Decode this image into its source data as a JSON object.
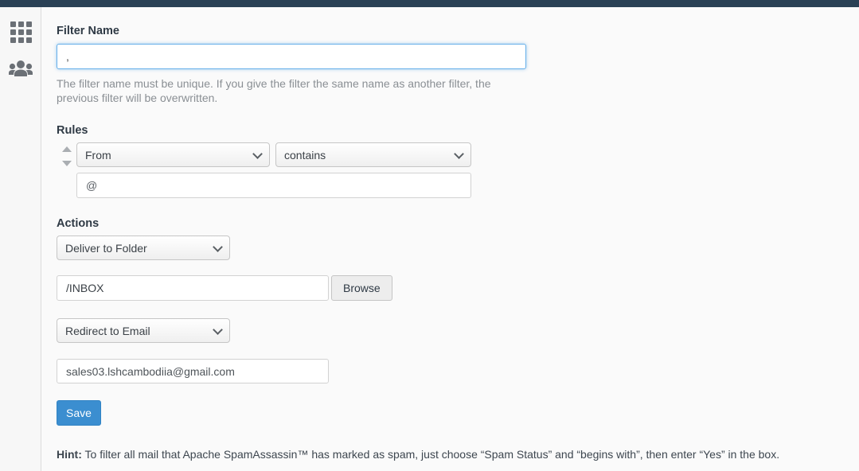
{
  "topbar": {
    "color": "#2a4155"
  },
  "sidebar": {
    "items": [
      {
        "icon": "apps-grid-icon",
        "name": "apps-grid"
      },
      {
        "icon": "users-group-icon",
        "name": "users-group"
      }
    ]
  },
  "form": {
    "filter_name": {
      "label": "Filter Name",
      "value": ",",
      "placeholder": "",
      "helper": "The filter name must be unique. If you give the filter the same name as another filter, the previous filter will be overwritten."
    },
    "rules": {
      "title": "Rules",
      "field_select": {
        "value": "From"
      },
      "operator_select": {
        "value": "contains"
      },
      "value_input": {
        "value": "@",
        "placeholder": ""
      },
      "reorder": {
        "up": "move-rule-up",
        "down": "move-rule-down"
      }
    },
    "actions": {
      "title": "Actions",
      "action_one": {
        "value": "Deliver to Folder"
      },
      "folder_input": {
        "value": "/INBOX",
        "placeholder": ""
      },
      "browse_label": "Browse",
      "action_two": {
        "value": "Redirect to Email"
      },
      "email_input": {
        "value": "sales03.lshcambodiia@gmail.com",
        "placeholder": ""
      }
    },
    "save_label": "Save"
  },
  "hint": {
    "prefix": "Hint:",
    "text": " To filter all mail that Apache SpamAssassin™ has marked as spam, just choose “Spam Status” and “begins with”, then enter “Yes” in the box."
  },
  "colors": {
    "topbar": "#2a4155",
    "accent": "#3b8ed0",
    "focus_ring": "#66afe9",
    "page_bg": "#fafafa",
    "sidebar_bg": "#f7f7f7"
  }
}
